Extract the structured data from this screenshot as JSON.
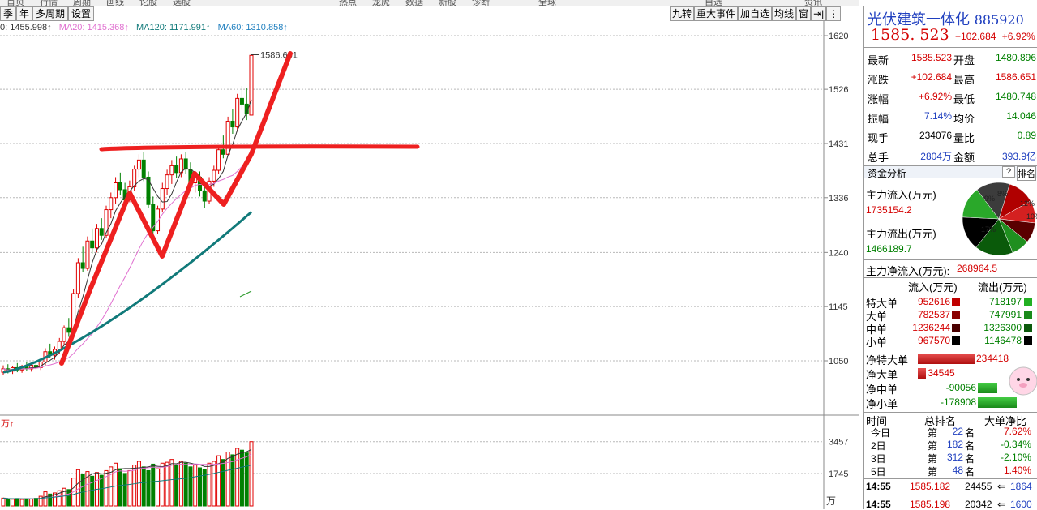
{
  "toolbar": {
    "periods": [
      "季",
      "年",
      "多周期",
      "设置"
    ],
    "tools": [
      "九转",
      "重大事件",
      "加自选",
      "均线",
      "窗",
      "⇥|",
      "⋮"
    ],
    "top_strip": [
      "首页",
      "行情",
      "周期",
      "画线",
      "论股",
      "选股",
      "",
      "",
      "",
      "",
      "热点",
      "龙虎",
      "数据",
      "新股",
      "诊断",
      "",
      "全球",
      "",
      "",
      "",
      "",
      "自选",
      "",
      "",
      "资讯"
    ]
  },
  "ma": {
    "ma5": "0: 1455.998↑",
    "ma20": "MA20: 1415.368↑",
    "ma120": "MA120: 1171.991↑",
    "ma60": "MA60: 1310.858↑"
  },
  "chart_data": {
    "type": "candlestick",
    "price_axis_ticks": [
      1620,
      1526,
      1431,
      1336,
      1240,
      1145,
      1050
    ],
    "price_ylim": [
      970,
      1660
    ],
    "high_label": "1586.651",
    "volume_axis_ticks": [
      3457,
      1745
    ],
    "volume_unit": "万",
    "volume_top_label": "万↑",
    "candles": [
      {
        "o": 1030,
        "h": 1042,
        "l": 1025,
        "c": 1036
      },
      {
        "o": 1036,
        "h": 1044,
        "l": 1028,
        "c": 1032
      },
      {
        "o": 1032,
        "h": 1040,
        "l": 1027,
        "c": 1038
      },
      {
        "o": 1038,
        "h": 1046,
        "l": 1030,
        "c": 1034
      },
      {
        "o": 1034,
        "h": 1043,
        "l": 1029,
        "c": 1040
      },
      {
        "o": 1040,
        "h": 1048,
        "l": 1033,
        "c": 1036
      },
      {
        "o": 1036,
        "h": 1045,
        "l": 1031,
        "c": 1042
      },
      {
        "o": 1042,
        "h": 1050,
        "l": 1035,
        "c": 1038
      },
      {
        "o": 1038,
        "h": 1052,
        "l": 1034,
        "c": 1048
      },
      {
        "o": 1048,
        "h": 1072,
        "l": 1042,
        "c": 1066
      },
      {
        "o": 1066,
        "h": 1080,
        "l": 1055,
        "c": 1060
      },
      {
        "o": 1060,
        "h": 1075,
        "l": 1052,
        "c": 1070
      },
      {
        "o": 1070,
        "h": 1090,
        "l": 1062,
        "c": 1084
      },
      {
        "o": 1084,
        "h": 1112,
        "l": 1078,
        "c": 1108
      },
      {
        "o": 1108,
        "h": 1125,
        "l": 1092,
        "c": 1100
      },
      {
        "o": 1100,
        "h": 1175,
        "l": 1095,
        "c": 1168
      },
      {
        "o": 1168,
        "h": 1230,
        "l": 1160,
        "c": 1222
      },
      {
        "o": 1222,
        "h": 1250,
        "l": 1205,
        "c": 1212
      },
      {
        "o": 1212,
        "h": 1268,
        "l": 1208,
        "c": 1260
      },
      {
        "o": 1260,
        "h": 1282,
        "l": 1238,
        "c": 1248
      },
      {
        "o": 1248,
        "h": 1290,
        "l": 1240,
        "c": 1282
      },
      {
        "o": 1282,
        "h": 1300,
        "l": 1262,
        "c": 1270
      },
      {
        "o": 1270,
        "h": 1322,
        "l": 1265,
        "c": 1315
      },
      {
        "o": 1315,
        "h": 1345,
        "l": 1300,
        "c": 1336
      },
      {
        "o": 1336,
        "h": 1372,
        "l": 1325,
        "c": 1362
      },
      {
        "o": 1362,
        "h": 1380,
        "l": 1340,
        "c": 1350
      },
      {
        "o": 1350,
        "h": 1362,
        "l": 1325,
        "c": 1332
      },
      {
        "o": 1332,
        "h": 1366,
        "l": 1328,
        "c": 1355
      },
      {
        "o": 1355,
        "h": 1392,
        "l": 1348,
        "c": 1386
      },
      {
        "o": 1386,
        "h": 1412,
        "l": 1372,
        "c": 1402
      },
      {
        "o": 1402,
        "h": 1416,
        "l": 1365,
        "c": 1372
      },
      {
        "o": 1372,
        "h": 1382,
        "l": 1318,
        "c": 1324
      },
      {
        "o": 1324,
        "h": 1338,
        "l": 1268,
        "c": 1278
      },
      {
        "o": 1278,
        "h": 1322,
        "l": 1272,
        "c": 1316
      },
      {
        "o": 1316,
        "h": 1362,
        "l": 1310,
        "c": 1352
      },
      {
        "o": 1352,
        "h": 1385,
        "l": 1340,
        "c": 1376
      },
      {
        "o": 1376,
        "h": 1402,
        "l": 1360,
        "c": 1392
      },
      {
        "o": 1392,
        "h": 1408,
        "l": 1370,
        "c": 1380
      },
      {
        "o": 1380,
        "h": 1412,
        "l": 1372,
        "c": 1404
      },
      {
        "o": 1404,
        "h": 1416,
        "l": 1378,
        "c": 1386
      },
      {
        "o": 1386,
        "h": 1398,
        "l": 1352,
        "c": 1362
      },
      {
        "o": 1362,
        "h": 1380,
        "l": 1345,
        "c": 1372
      },
      {
        "o": 1372,
        "h": 1382,
        "l": 1338,
        "c": 1348
      },
      {
        "o": 1348,
        "h": 1358,
        "l": 1318,
        "c": 1330
      },
      {
        "o": 1330,
        "h": 1372,
        "l": 1325,
        "c": 1365
      },
      {
        "o": 1365,
        "h": 1392,
        "l": 1355,
        "c": 1384
      },
      {
        "o": 1384,
        "h": 1428,
        "l": 1378,
        "c": 1420
      },
      {
        "o": 1420,
        "h": 1445,
        "l": 1405,
        "c": 1412
      },
      {
        "o": 1412,
        "h": 1478,
        "l": 1408,
        "c": 1470
      },
      {
        "o": 1470,
        "h": 1492,
        "l": 1448,
        "c": 1460
      },
      {
        "o": 1460,
        "h": 1518,
        "l": 1452,
        "c": 1510
      },
      {
        "o": 1510,
        "h": 1532,
        "l": 1490,
        "c": 1500
      },
      {
        "o": 1500,
        "h": 1528,
        "l": 1472,
        "c": 1484
      },
      {
        "o": 1480.748,
        "h": 1586.651,
        "l": 1480.748,
        "c": 1585.523
      }
    ],
    "volumes": [
      420,
      380,
      360,
      400,
      350,
      390,
      370,
      410,
      520,
      760,
      640,
      700,
      820,
      950,
      880,
      1500,
      1950,
      1700,
      1850,
      1600,
      1800,
      1650,
      1900,
      2100,
      2300,
      2000,
      1750,
      1900,
      2200,
      2400,
      2100,
      1900,
      2250,
      2000,
      2300,
      2350,
      2500,
      2200,
      2400,
      2300,
      2100,
      2200,
      2050,
      1950,
      2300,
      2400,
      2700,
      2500,
      2900,
      2750,
      3100,
      3000,
      2850,
      3457
    ]
  },
  "stock": {
    "name": "光伏建筑一体化",
    "code": "885920",
    "price": "1585. 523",
    "change": "+102.684",
    "pct": "+6.92%"
  },
  "quote_rows": [
    {
      "l1": "最新",
      "v1": "1585.523",
      "c1": "red",
      "l2": "开盘",
      "v2": "1480.896",
      "c2": "green"
    },
    {
      "l1": "涨跌",
      "v1": "+102.684",
      "c1": "red",
      "l2": "最高",
      "v2": "1586.651",
      "c2": "red"
    },
    {
      "l1": "涨幅",
      "v1": "+6.92%",
      "c1": "red",
      "l2": "最低",
      "v2": "1480.748",
      "c2": "green"
    },
    {
      "l1": "振幅",
      "v1": "7.14%",
      "c1": "blue",
      "l2": "均价",
      "v2": "14.046",
      "c2": "green"
    },
    {
      "l1": "现手",
      "v1": "234076",
      "c1": "black",
      "l2": "量比",
      "v2": "0.89",
      "c2": "green"
    },
    {
      "l1": "总手",
      "v1": "2804万",
      "c1": "blue",
      "l2": "金额",
      "v2": "393.9亿",
      "c2": "blue"
    }
  ],
  "fund": {
    "header": "资金分析",
    "help": "?",
    "rank": "排名",
    "inflow_label": "主力流入(万元)",
    "inflow_value": "1735154.2",
    "outflow_label": "主力流出(万元)",
    "outflow_value": "1466189.7",
    "net_label": "主力净流入(万元):",
    "net_value": "268964.5",
    "pie_labels": [
      "12%",
      "10%",
      "9%",
      "8%",
      "17%"
    ],
    "pie_slices": [
      12,
      10,
      9,
      8,
      17,
      15,
      14,
      15
    ],
    "col_in": "流入(万元)",
    "col_out": "流出(万元)",
    "rows": [
      {
        "label": "特大单",
        "in": "952616",
        "out": "718197"
      },
      {
        "label": "大单",
        "in": "782537",
        "out": "747991"
      },
      {
        "label": "中单",
        "in": "1236244",
        "out": "1326300"
      },
      {
        "label": "小单",
        "in": "967570",
        "out": "1146478"
      }
    ],
    "net_rows": [
      {
        "label": "净特大单",
        "value": "234418",
        "num": 234418
      },
      {
        "label": "净大单",
        "value": "34545",
        "num": 34545
      },
      {
        "label": "净中单",
        "value": "-90056",
        "num": -90056
      },
      {
        "label": "净小单",
        "value": "-178908",
        "num": -178908
      }
    ]
  },
  "rank": {
    "headers": [
      "时间",
      "总排名",
      "大单净比"
    ],
    "rows": [
      {
        "t": "今日",
        "pre": "第",
        "n": "22",
        "suf": "名",
        "pct": "7.62%",
        "c": "red"
      },
      {
        "t": "2日",
        "pre": "第",
        "n": "182",
        "suf": "名",
        "pct": "-0.34%",
        "c": "green"
      },
      {
        "t": "3日",
        "pre": "第",
        "n": "312",
        "suf": "名",
        "pct": "-2.10%",
        "c": "green"
      },
      {
        "t": "5日",
        "pre": "第",
        "n": "48",
        "suf": "名",
        "pct": "1.40%",
        "c": "red"
      }
    ]
  },
  "ticks": [
    {
      "time": "14:55",
      "price": "1585.182",
      "vol": "24455",
      "dir": "⇐",
      "last": "1864"
    },
    {
      "time": "14:55",
      "price": "1585.198",
      "vol": "20342",
      "dir": "⇐",
      "last": "1600"
    }
  ]
}
